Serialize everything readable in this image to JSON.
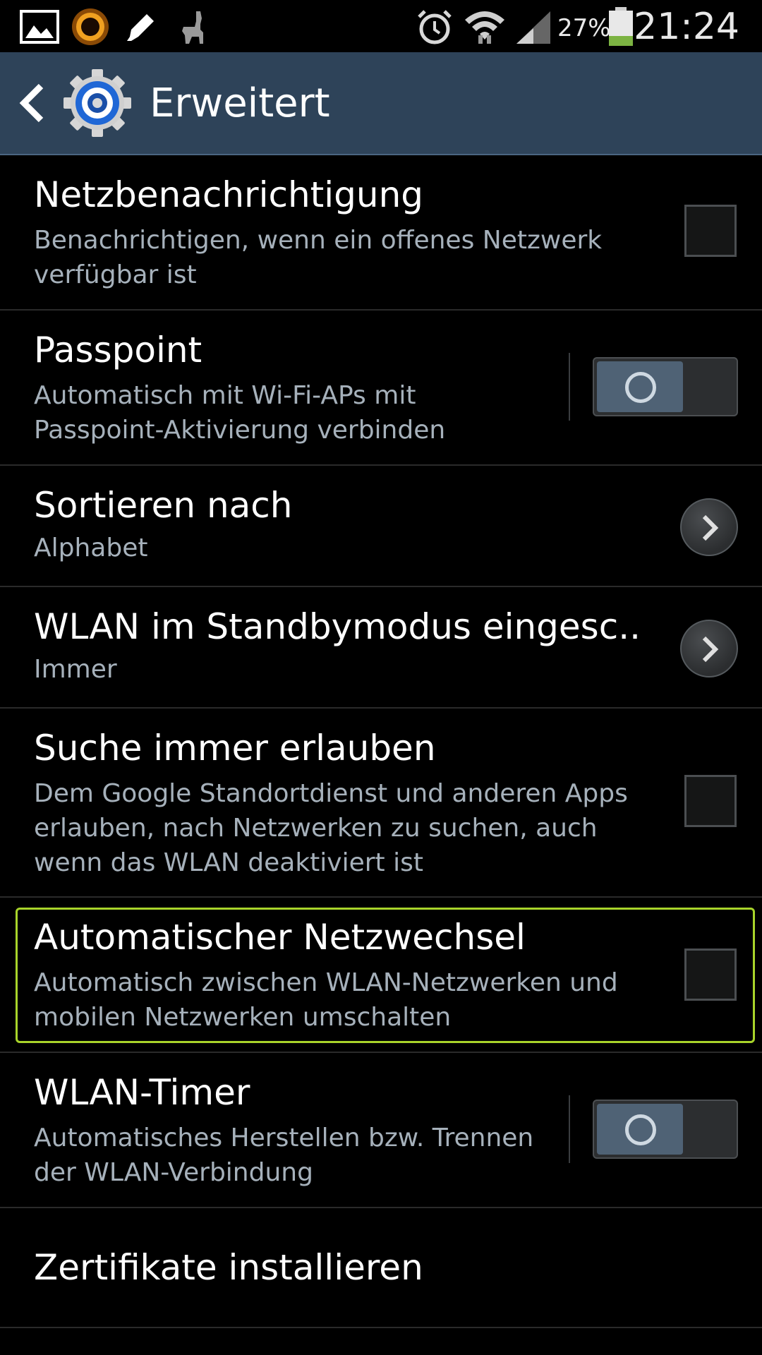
{
  "status_bar": {
    "icons": [
      "gallery-icon",
      "sunflower-icon",
      "pencil-icon",
      "llama-icon",
      "alarm-icon",
      "wifi-icon",
      "signal-icon",
      "battery-icon"
    ],
    "battery_percent": "27%",
    "time": "21:24",
    "battery_level": 0.27,
    "battery_color": "#7cb342"
  },
  "action_bar": {
    "title": "Erweitert",
    "back_icon": "chevron-left-icon",
    "app_icon": "settings-gear-icon",
    "background": "#2e4359"
  },
  "items": [
    {
      "title": "Netzbenachrichtigung",
      "subtitle": "Benachrichtigen, wenn ein offenes Netzwerk verfügbar ist",
      "control": "checkbox",
      "checked": false
    },
    {
      "title": "Passpoint",
      "subtitle": "Automatisch mit Wi-Fi-APs mit Passpoint-Aktivierung verbinden",
      "control": "toggle",
      "on": false
    },
    {
      "title": "Sortieren nach",
      "subtitle": "Alphabet",
      "control": "chevron"
    },
    {
      "title": "WLAN im Standbymodus eingesc..",
      "subtitle": "Immer",
      "control": "chevron"
    },
    {
      "title": "Suche immer erlauben",
      "subtitle": "Dem Google Standortdienst und anderen Apps erlauben, nach Netzwerken zu suchen, auch wenn das WLAN deaktiviert ist",
      "control": "checkbox",
      "checked": false
    },
    {
      "title": "Automatischer Netzwechsel",
      "subtitle": "Automatisch zwischen WLAN-Netzwerken und mobilen Netzwerken umschalten",
      "control": "checkbox",
      "checked": false,
      "focused": true
    },
    {
      "title": "WLAN-Timer",
      "subtitle": "Automatisches Herstellen bzw. Trennen der WLAN-Verbindung",
      "control": "toggle",
      "on": false
    },
    {
      "title": "Zertifikate installieren",
      "control": "none"
    }
  ],
  "colors": {
    "background": "#000000",
    "title_text": "#ffffff",
    "subtitle_text": "#a6b1bb",
    "focus_outline": "#a8d42a",
    "divider": "#2a2a2a"
  }
}
